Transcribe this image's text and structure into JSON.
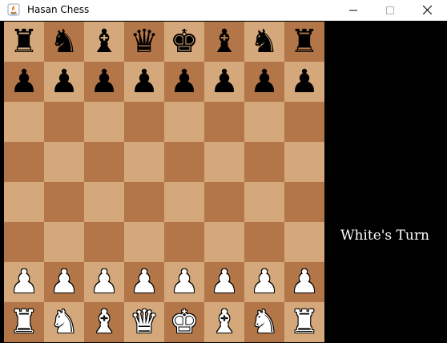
{
  "window": {
    "title": "Hasan Chess",
    "icon": "java-icon",
    "controls": [
      "minimize",
      "maximize",
      "close"
    ]
  },
  "colors": {
    "light_square": "#d5a87b",
    "dark_square": "#b27648",
    "panel_background": "#000000",
    "turn_text": "#ffffff"
  },
  "board": {
    "ranks": [
      [
        "r",
        "n",
        "b",
        "q",
        "k",
        "b",
        "n",
        "r"
      ],
      [
        "p",
        "p",
        "p",
        "p",
        "p",
        "p",
        "p",
        "p"
      ],
      [
        "",
        "",
        "",
        "",
        "",
        "",
        "",
        ""
      ],
      [
        "",
        "",
        "",
        "",
        "",
        "",
        "",
        ""
      ],
      [
        "",
        "",
        "",
        "",
        "",
        "",
        "",
        ""
      ],
      [
        "",
        "",
        "",
        "",
        "",
        "",
        "",
        ""
      ],
      [
        "P",
        "P",
        "P",
        "P",
        "P",
        "P",
        "P",
        "P"
      ],
      [
        "R",
        "N",
        "B",
        "Q",
        "K",
        "B",
        "N",
        "R"
      ]
    ]
  },
  "status": {
    "turn": "White's Turn"
  }
}
